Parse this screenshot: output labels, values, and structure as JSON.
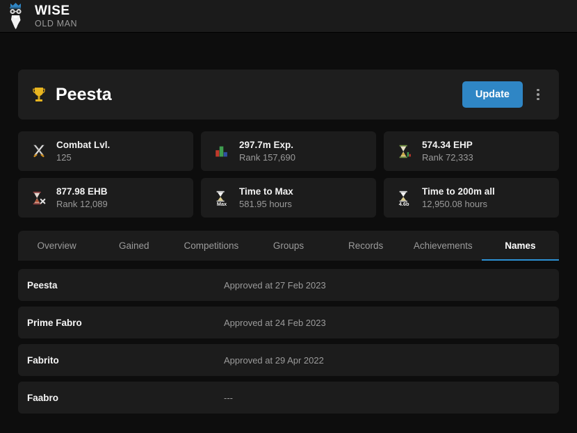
{
  "brand": {
    "title": "WISE",
    "subtitle": "OLD MAN",
    "logo_icon": "old-man-crown-icon",
    "crown_color": "#2f86c5"
  },
  "player": {
    "icon": "trophy-icon",
    "name": "Peesta",
    "update_label": "Update",
    "menu_icon": "kebab-menu-icon",
    "accent_color": "#2f86c5"
  },
  "stats": [
    {
      "icon": "crossed-swords-icon",
      "title": "Combat Lvl.",
      "sub": "125"
    },
    {
      "icon": "bar-chart-icon",
      "title": "297.7m Exp.",
      "sub": "Rank 157,690"
    },
    {
      "icon": "hourglass-green-icon",
      "title": "574.34 EHP",
      "sub": "Rank 72,333"
    },
    {
      "icon": "hourglass-red-icon",
      "title": "877.98 EHB",
      "sub": "Rank 12,089"
    },
    {
      "icon": "hourglass-max-icon",
      "title": "Time to Max",
      "sub": "581.95 hours",
      "badge": "Max"
    },
    {
      "icon": "hourglass-200m-icon",
      "title": "Time to 200m all",
      "sub": "12,950.08 hours",
      "badge": "4.6b"
    }
  ],
  "tabs": [
    {
      "label": "Overview",
      "active": false
    },
    {
      "label": "Gained",
      "active": false
    },
    {
      "label": "Competitions",
      "active": false
    },
    {
      "label": "Groups",
      "active": false
    },
    {
      "label": "Records",
      "active": false
    },
    {
      "label": "Achievements",
      "active": false
    },
    {
      "label": "Names",
      "active": true
    }
  ],
  "active_tab_color": "#2d91d4",
  "names": [
    {
      "name": "Peesta",
      "date": "Approved at 27 Feb 2023"
    },
    {
      "name": "Prime Fabro",
      "date": "Approved at 24 Feb 2023"
    },
    {
      "name": "Fabrito",
      "date": "Approved at 29 Apr 2022"
    },
    {
      "name": "Faabro",
      "date": "---"
    }
  ]
}
